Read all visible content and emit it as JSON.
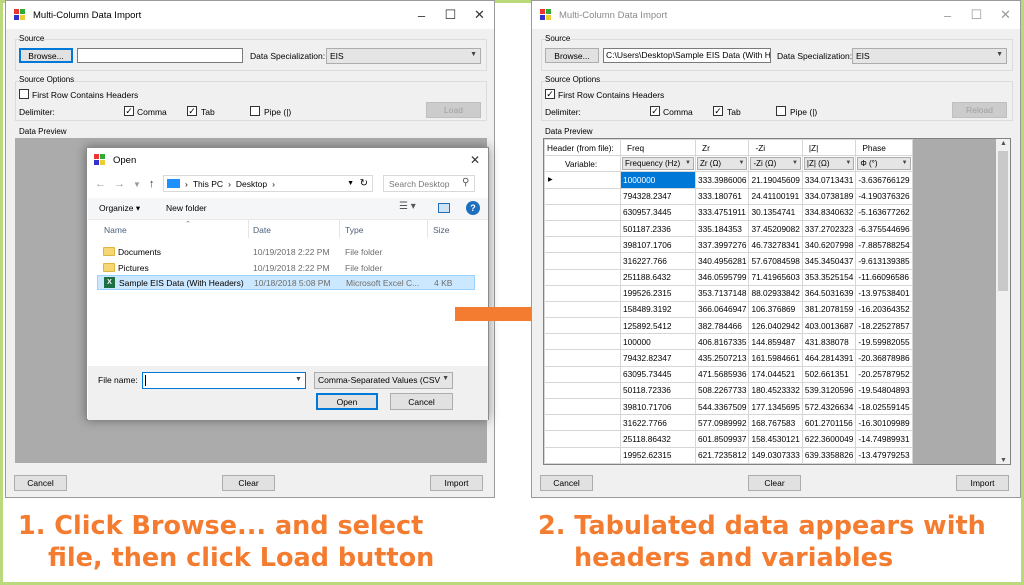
{
  "left_window": {
    "title": "Multi-Column Data Import",
    "source_label": "Source",
    "browse_label": "Browse...",
    "path_value": "",
    "specialization_label": "Data Specialization:",
    "specialization_value": "EIS",
    "source_options_label": "Source Options",
    "first_row_label": "First Row Contains Headers",
    "first_row_checked": false,
    "delimiter_label": "Delimiter:",
    "comma_label": "Comma",
    "comma_checked": true,
    "tab_label": "Tab",
    "tab_checked": true,
    "pipe_label": "Pipe (|)",
    "pipe_checked": false,
    "load_label": "Load",
    "data_preview_label": "Data Preview",
    "cancel_label": "Cancel",
    "clear_label": "Clear",
    "import_label": "Import"
  },
  "open_dialog": {
    "title": "Open",
    "breadcrumb": [
      "This PC",
      "Desktop"
    ],
    "search_placeholder": "Search Desktop",
    "organize_label": "Organize ▾",
    "new_folder_label": "New folder",
    "columns": {
      "name": "Name",
      "date": "Date",
      "type": "Type",
      "size": "Size"
    },
    "files": [
      {
        "name": "Documents",
        "date": "10/19/2018 2:22 PM",
        "type": "File folder",
        "size": "",
        "kind": "folder",
        "selected": false
      },
      {
        "name": "Pictures",
        "date": "10/19/2018 2:22 PM",
        "type": "File folder",
        "size": "",
        "kind": "folder",
        "selected": false
      },
      {
        "name": "Sample EIS Data (With Headers)",
        "date": "10/18/2018 5:08 PM",
        "type": "Microsoft Excel C...",
        "size": "4 KB",
        "kind": "excel",
        "selected": true
      }
    ],
    "filename_label": "File name:",
    "filename_value": "",
    "filetype_value": "Comma-Separated Values (CSV",
    "open_label": "Open",
    "cancel_label": "Cancel"
  },
  "right_window": {
    "title": "Multi-Column Data Import",
    "source_label": "Source",
    "browse_label": "Browse...",
    "path_value": "C:\\Users\\Desktop\\Sample EIS Data (With He",
    "specialization_label": "Data Specialization:",
    "specialization_value": "EIS",
    "source_options_label": "Source Options",
    "first_row_label": "First Row Contains Headers",
    "first_row_checked": true,
    "delimiter_label": "Delimiter:",
    "comma_label": "Comma",
    "comma_checked": true,
    "tab_label": "Tab",
    "tab_checked": true,
    "pipe_label": "Pipe (|)",
    "pipe_checked": false,
    "reload_label": "Reload",
    "data_preview_label": "Data Preview",
    "header_from_file_label": "Header (from file):",
    "variable_label": "Variable:",
    "headers": [
      "Freq",
      "Zr",
      "-Zi",
      "|Z|",
      "Phase"
    ],
    "variables": [
      "Frequency (Hz)",
      "Zr (Ω)",
      "-Zi (Ω)",
      "|Z| (Ω)",
      "Φ (°)"
    ],
    "rows": [
      [
        "1000000",
        "333.3986006",
        "21.19045609",
        "334.0713431",
        "-3.636766129"
      ],
      [
        "794328.2347",
        "333.180761",
        "24.41100191",
        "334.0738189",
        "-4.190376326"
      ],
      [
        "630957.3445",
        "333.4751911",
        "30.1354741",
        "334.8340632",
        "-5.163677262"
      ],
      [
        "501187.2336",
        "335.184353",
        "37.45209082",
        "337.2702323",
        "-6.375544696"
      ],
      [
        "398107.1706",
        "337.3997276",
        "46.73278341",
        "340.6207998",
        "-7.885788254"
      ],
      [
        "316227.766",
        "340.4956281",
        "57.67084598",
        "345.3450437",
        "-9.613139385"
      ],
      [
        "251188.6432",
        "346.0595799",
        "71.41965603",
        "353.3525154",
        "-11.66096586"
      ],
      [
        "199526.2315",
        "353.7137148",
        "88.02933842",
        "364.5031639",
        "-13.97538401"
      ],
      [
        "158489.3192",
        "366.0646947",
        "106.376869",
        "381.2078159",
        "-16.20364352"
      ],
      [
        "125892.5412",
        "382.784466",
        "126.0402942",
        "403.0013687",
        "-18.22527857"
      ],
      [
        "100000",
        "406.8167335",
        "144.859487",
        "431.838078",
        "-19.59982055"
      ],
      [
        "79432.82347",
        "435.2507213",
        "161.5984661",
        "464.2814391",
        "-20.36878986"
      ],
      [
        "63095.73445",
        "471.5685936",
        "174.044521",
        "502.661351",
        "-20.25787952"
      ],
      [
        "50118.72336",
        "508.2267733",
        "180.4523332",
        "539.3120596",
        "-19.54804893"
      ],
      [
        "39810.71706",
        "544.3367509",
        "177.1345695",
        "572.4326634",
        "-18.02559145"
      ],
      [
        "31622.7766",
        "577.0989992",
        "168.767583",
        "601.2701156",
        "-16.30109989"
      ],
      [
        "25118.86432",
        "601.8509937",
        "158.4530121",
        "622.3600049",
        "-14.74989931"
      ],
      [
        "19952.62315",
        "621.7235812",
        "149.0307333",
        "639.3358826",
        "-13.47979253"
      ]
    ],
    "cancel_label": "Cancel",
    "clear_label": "Clear",
    "import_label": "Import"
  },
  "captions": {
    "step1_line1": "1. Click Browse... and select",
    "step1_line2": "file, then click Load button",
    "step2_line1": "2. Tabulated data appears with",
    "step2_line2": "headers and variables"
  },
  "colors": {
    "frame": "#b9d97a",
    "caption": "#f47c30",
    "arrow": "#f47c30",
    "selection": "#0078d7"
  }
}
